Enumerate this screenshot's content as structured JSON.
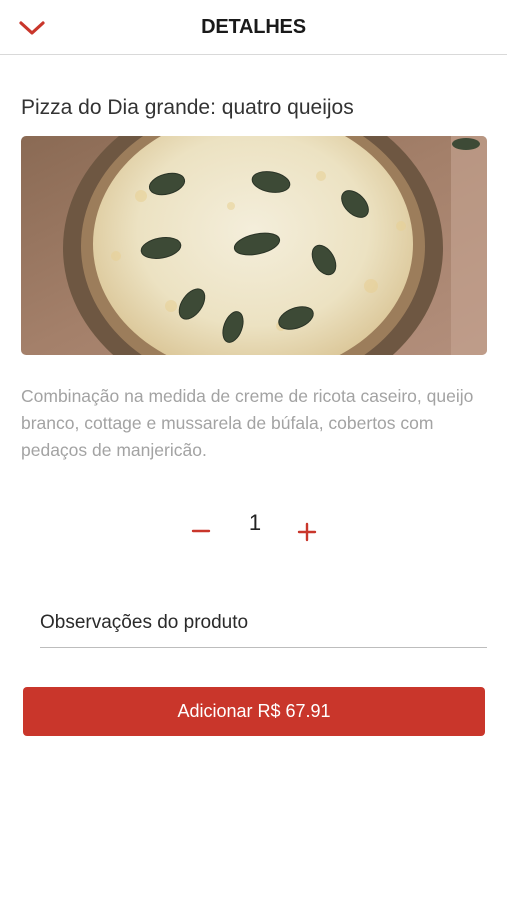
{
  "header": {
    "title": "DETALHES",
    "back_icon": "chevron-down-icon"
  },
  "product": {
    "title": "Pizza do Dia grande: quatro queijos",
    "image_description_icon": "pizza-photo",
    "description": "Combinação na medida de creme de ricota caseiro, queijo branco, cottage e mussarela de búfala, cobertos com pedaços de manjericão."
  },
  "quantity": {
    "value": "1",
    "minus_icon": "minus-icon",
    "plus_icon": "plus-icon"
  },
  "notes": {
    "placeholder": "Observações do produto",
    "value": ""
  },
  "add_button": {
    "label": "Adicionar R$ 67.91"
  },
  "colors": {
    "accent": "#c9362b",
    "description_text": "#a3a3a3",
    "divider": "#d9d9d9"
  }
}
